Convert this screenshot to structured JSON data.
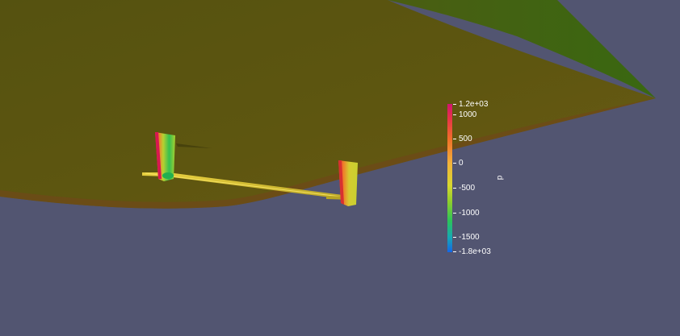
{
  "viewport": {
    "background_color": "#525571"
  },
  "scene": {
    "objects": [
      "ship-hull",
      "rudder-left",
      "rudder-right",
      "propeller-shaft"
    ],
    "colors": {
      "hull": "#5a5a10",
      "hull_edge": "#6a4a14",
      "hull_bow": "#3d6a08"
    }
  },
  "legend": {
    "title": "p",
    "max_label": "1.2e+03",
    "min_label": "-1.8e+03",
    "range": [
      -1800,
      1200
    ],
    "ticks": [
      {
        "label": "1000",
        "value": 1000
      },
      {
        "label": "500",
        "value": 500
      },
      {
        "label": "0",
        "value": 0
      },
      {
        "label": "-500",
        "value": -500
      },
      {
        "label": "-1000",
        "value": -1000
      },
      {
        "label": "-1500",
        "value": -1500
      }
    ]
  }
}
